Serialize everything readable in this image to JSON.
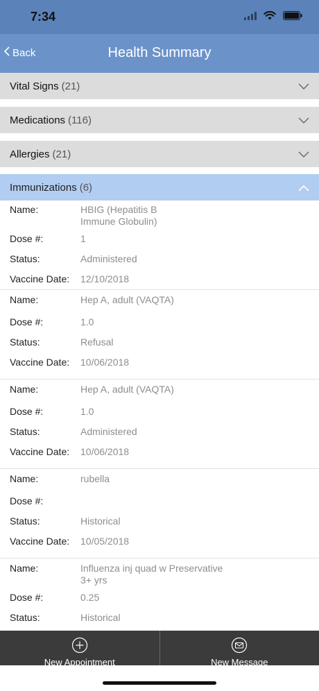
{
  "status_bar": {
    "time": "7:34"
  },
  "nav": {
    "back_label": "Back",
    "title": "Health Summary"
  },
  "sections": [
    {
      "name": "Vital Signs",
      "count": "(21)"
    },
    {
      "name": "Medications",
      "count": "(116)"
    },
    {
      "name": "Allergies",
      "count": "(21)"
    },
    {
      "name": "Immunizations",
      "count": "(6)"
    }
  ],
  "labels": {
    "name": "Name:",
    "dose": "Dose #:",
    "status": "Status:",
    "date": "Vaccine Date:"
  },
  "immunizations": [
    {
      "name": "HBIG (Hepatitis B\nImmune Globulin)",
      "dose": "1",
      "status": "Administered",
      "date": "12/10/2018"
    },
    {
      "name": "Hep A, adult (VAQTA)",
      "dose": "1.0",
      "status": "Refusal",
      "date": "10/06/2018"
    },
    {
      "name": "Hep A, adult (VAQTA)",
      "dose": "1.0",
      "status": "Administered",
      "date": "10/06/2018"
    },
    {
      "name": "rubella",
      "dose": "",
      "status": "Historical",
      "date": "10/05/2018"
    },
    {
      "name": "Influenza inj quad w Preservative\n3+ yrs",
      "dose": "0.25",
      "status": "Historical",
      "date": ""
    }
  ],
  "bottom_bar": {
    "appointment_label": "New Appointment",
    "message_label": "New Message"
  },
  "colors": {
    "status_bar": "#5b82b9",
    "nav_bar": "#6b93c9",
    "section_bg": "#dcdcdc",
    "section_open_bg": "#b2cdf2",
    "bottom_bar": "#3b3b3b"
  },
  "icons": {
    "back": "chevron-left-icon",
    "collapsed": "chevron-down-icon",
    "expanded": "chevron-up-icon",
    "appointment": "plus-circle-icon",
    "message": "envelope-circle-icon"
  }
}
